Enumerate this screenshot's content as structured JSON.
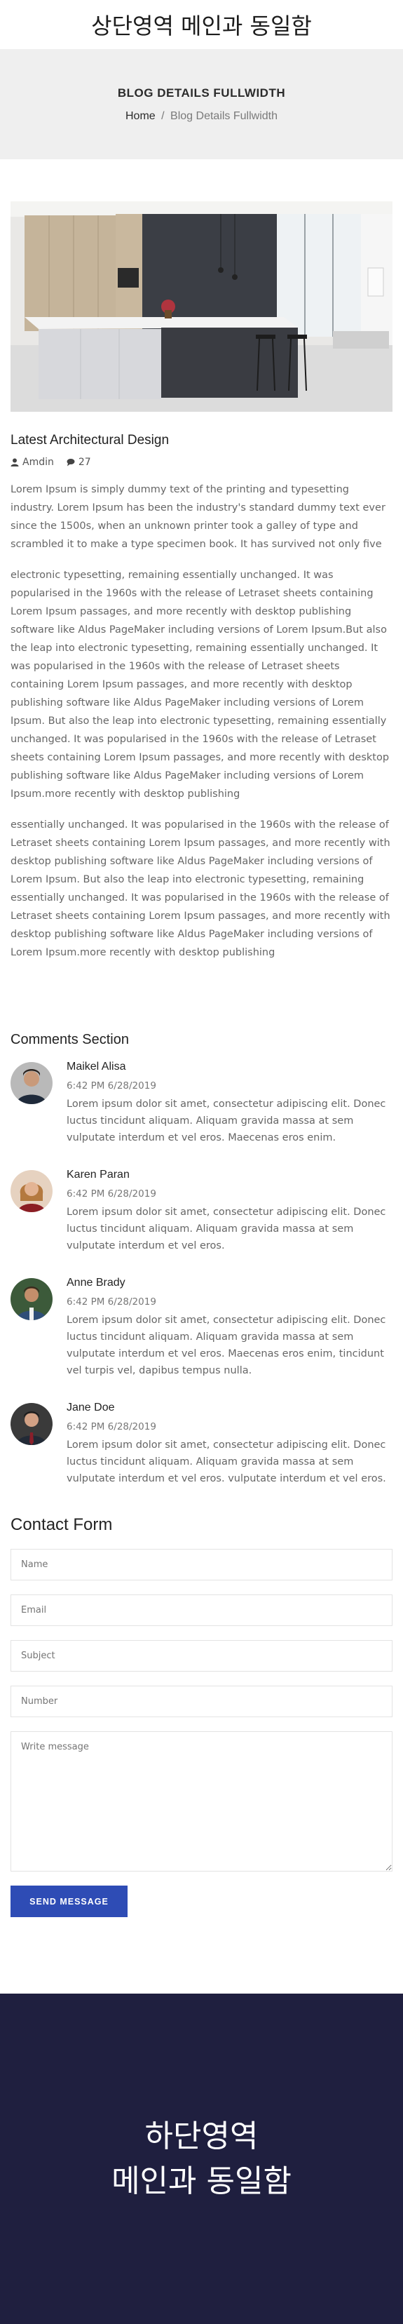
{
  "top_banner": {
    "text": "상단영역 메인과 동일함"
  },
  "page_header": {
    "title": "BLOG DETAILS FULLWIDTH",
    "breadcrumb": {
      "home": "Home",
      "separator": "/",
      "current": "Blog Details Fullwidth"
    }
  },
  "post": {
    "title": "Latest Architectural Design",
    "author": "Amdin",
    "comment_count": "27",
    "paragraphs": [
      "Lorem Ipsum is simply dummy text of the printing and typesetting industry. Lorem Ipsum has been the industry's standard dummy text ever since the 1500s, when an unknown printer took a galley of type and scrambled it to make a type specimen book. It has survived not only five",
      "electronic typesetting, remaining essentially unchanged. It was popularised in the 1960s with the release of Letraset sheets containing Lorem Ipsum passages, and more recently with desktop publishing software like Aldus PageMaker including versions of Lorem Ipsum.But also the leap into electronic typesetting, remaining essentially unchanged. It was popularised in the 1960s with the release of Letraset sheets containing Lorem Ipsum passages, and more recently with desktop publishing software like Aldus PageMaker including versions of Lorem Ipsum. But also the leap into electronic typesetting, remaining essentially unchanged. It was popularised in the 1960s with the release of Letraset sheets containing Lorem Ipsum passages, and more recently with desktop publishing software like Aldus PageMaker including versions of Lorem Ipsum.more recently with desktop publishing",
      "essentially unchanged. It was popularised in the 1960s with the release of Letraset sheets containing Lorem Ipsum passages, and more recently with desktop publishing software like Aldus PageMaker including versions of Lorem Ipsum. But also the leap into electronic typesetting, remaining essentially unchanged. It was popularised in the 1960s with the release of Letraset sheets containing Lorem Ipsum passages, and more recently with desktop publishing software like Aldus PageMaker including versions of Lorem Ipsum.more recently with desktop publishing"
    ]
  },
  "comments": {
    "title": "Comments Section",
    "items": [
      {
        "name": "Maikel Alisa",
        "date": "6:42 PM 6/28/2019",
        "text": "Lorem ipsum dolor sit amet, consectetur adipiscing elit. Donec luctus tincidunt aliquam. Aliquam gravida massa at sem vulputate interdum et vel eros. Maecenas eros enim."
      },
      {
        "name": "Karen Paran",
        "date": "6:42 PM 6/28/2019",
        "text": "Lorem ipsum dolor sit amet, consectetur adipiscing elit. Donec luctus tincidunt aliquam. Aliquam gravida massa at sem vulputate interdum et vel eros."
      },
      {
        "name": "Anne Brady",
        "date": "6:42 PM 6/28/2019",
        "text": "Lorem ipsum dolor sit amet, consectetur adipiscing elit. Donec luctus tincidunt aliquam. Aliquam gravida massa at sem vulputate interdum et vel eros. Maecenas eros enim, tincidunt vel turpis vel, dapibus tempus nulla."
      },
      {
        "name": "Jane Doe",
        "date": "6:42 PM 6/28/2019",
        "text": "Lorem ipsum dolor sit amet, consectetur adipiscing elit. Donec luctus tincidunt aliquam. Aliquam gravida massa at sem vulputate interdum et vel eros. vulputate interdum et vel eros."
      }
    ]
  },
  "contact": {
    "title": "Contact Form",
    "name_placeholder": "Name",
    "email_placeholder": "Email",
    "subject_placeholder": "Subject",
    "number_placeholder": "Number",
    "message_placeholder": "Write message",
    "send_label": "SEND MESSAGE"
  },
  "footer": {
    "line1": "하단영역",
    "line2": "메인과 동일함"
  },
  "colors": {
    "accent": "#2e4cb5",
    "footer_bg": "#1f1f3f",
    "header_bg": "#efefef"
  },
  "icons": {
    "author": "user-icon",
    "comments": "comment-icon"
  }
}
